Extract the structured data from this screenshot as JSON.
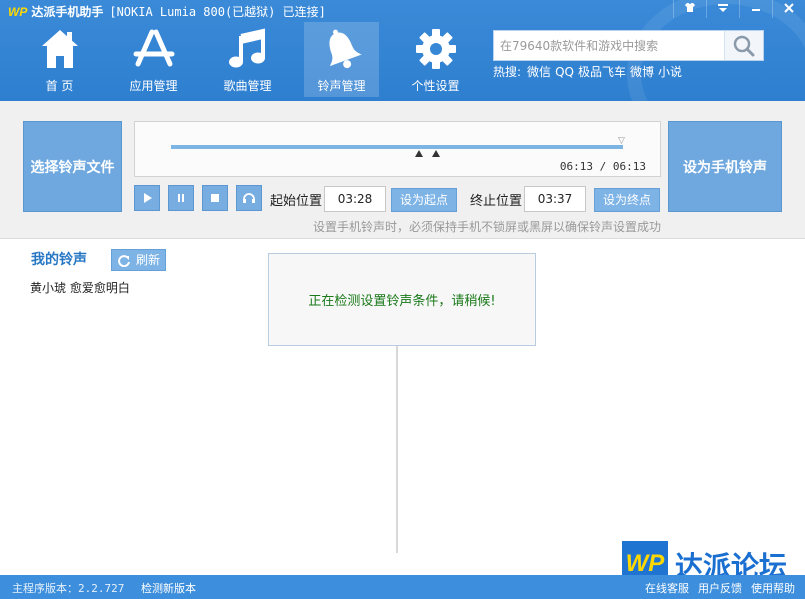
{
  "app": {
    "logo": "WP",
    "name": "达派手机助手",
    "device": "[NOKIA Lumia 800(已越狱) 已连接]"
  },
  "window_controls": [
    "shirt-icon",
    "menu-icon",
    "minimize-icon",
    "close-icon"
  ],
  "nav": {
    "items": [
      {
        "label": "首  页",
        "icon": "home-icon"
      },
      {
        "label": "应用管理",
        "icon": "appstore-icon"
      },
      {
        "label": "歌曲管理",
        "icon": "music-note-icon"
      },
      {
        "label": "铃声管理",
        "icon": "bell-icon",
        "active": true
      },
      {
        "label": "个性设置",
        "icon": "gear-icon"
      }
    ]
  },
  "search": {
    "placeholder": "在79640款软件和游戏中搜索"
  },
  "hot": {
    "label": "热搜:",
    "items": [
      "微信",
      "QQ",
      "极品飞车",
      "微博",
      "小说"
    ]
  },
  "ringtone": {
    "select_button": "选择铃声文件",
    "set_button": "设为手机铃声",
    "time_readout": "06:13 / 06:13",
    "start_label": "起始位置",
    "start_value": "03:28",
    "set_start_button": "设为起点",
    "end_label": "终止位置",
    "end_value": "03:37",
    "set_end_button": "设为终点",
    "hint": "设置手机铃声时，必须保持手机不锁屏或黑屏以确保铃声设置成功"
  },
  "my_ringtones": {
    "title": "我的铃声",
    "refresh": "刷新",
    "songs": [
      "黄小琥 愈爱愈明白"
    ]
  },
  "dialog": {
    "message": "正在检测设置铃声条件，请稍候!"
  },
  "watermark": {
    "logo": "WP",
    "text": "达派论坛"
  },
  "footer": {
    "version_label": "主程序版本：",
    "version": "2.2.727",
    "check_update": "检测新版本",
    "links": [
      "在线客服",
      "用户反馈",
      "使用帮助"
    ]
  },
  "colors": {
    "primary": "#3d8fdd",
    "button": "#6ea8df",
    "dialog_text": "#1a7a1a",
    "title_accent": "#2877c4"
  }
}
